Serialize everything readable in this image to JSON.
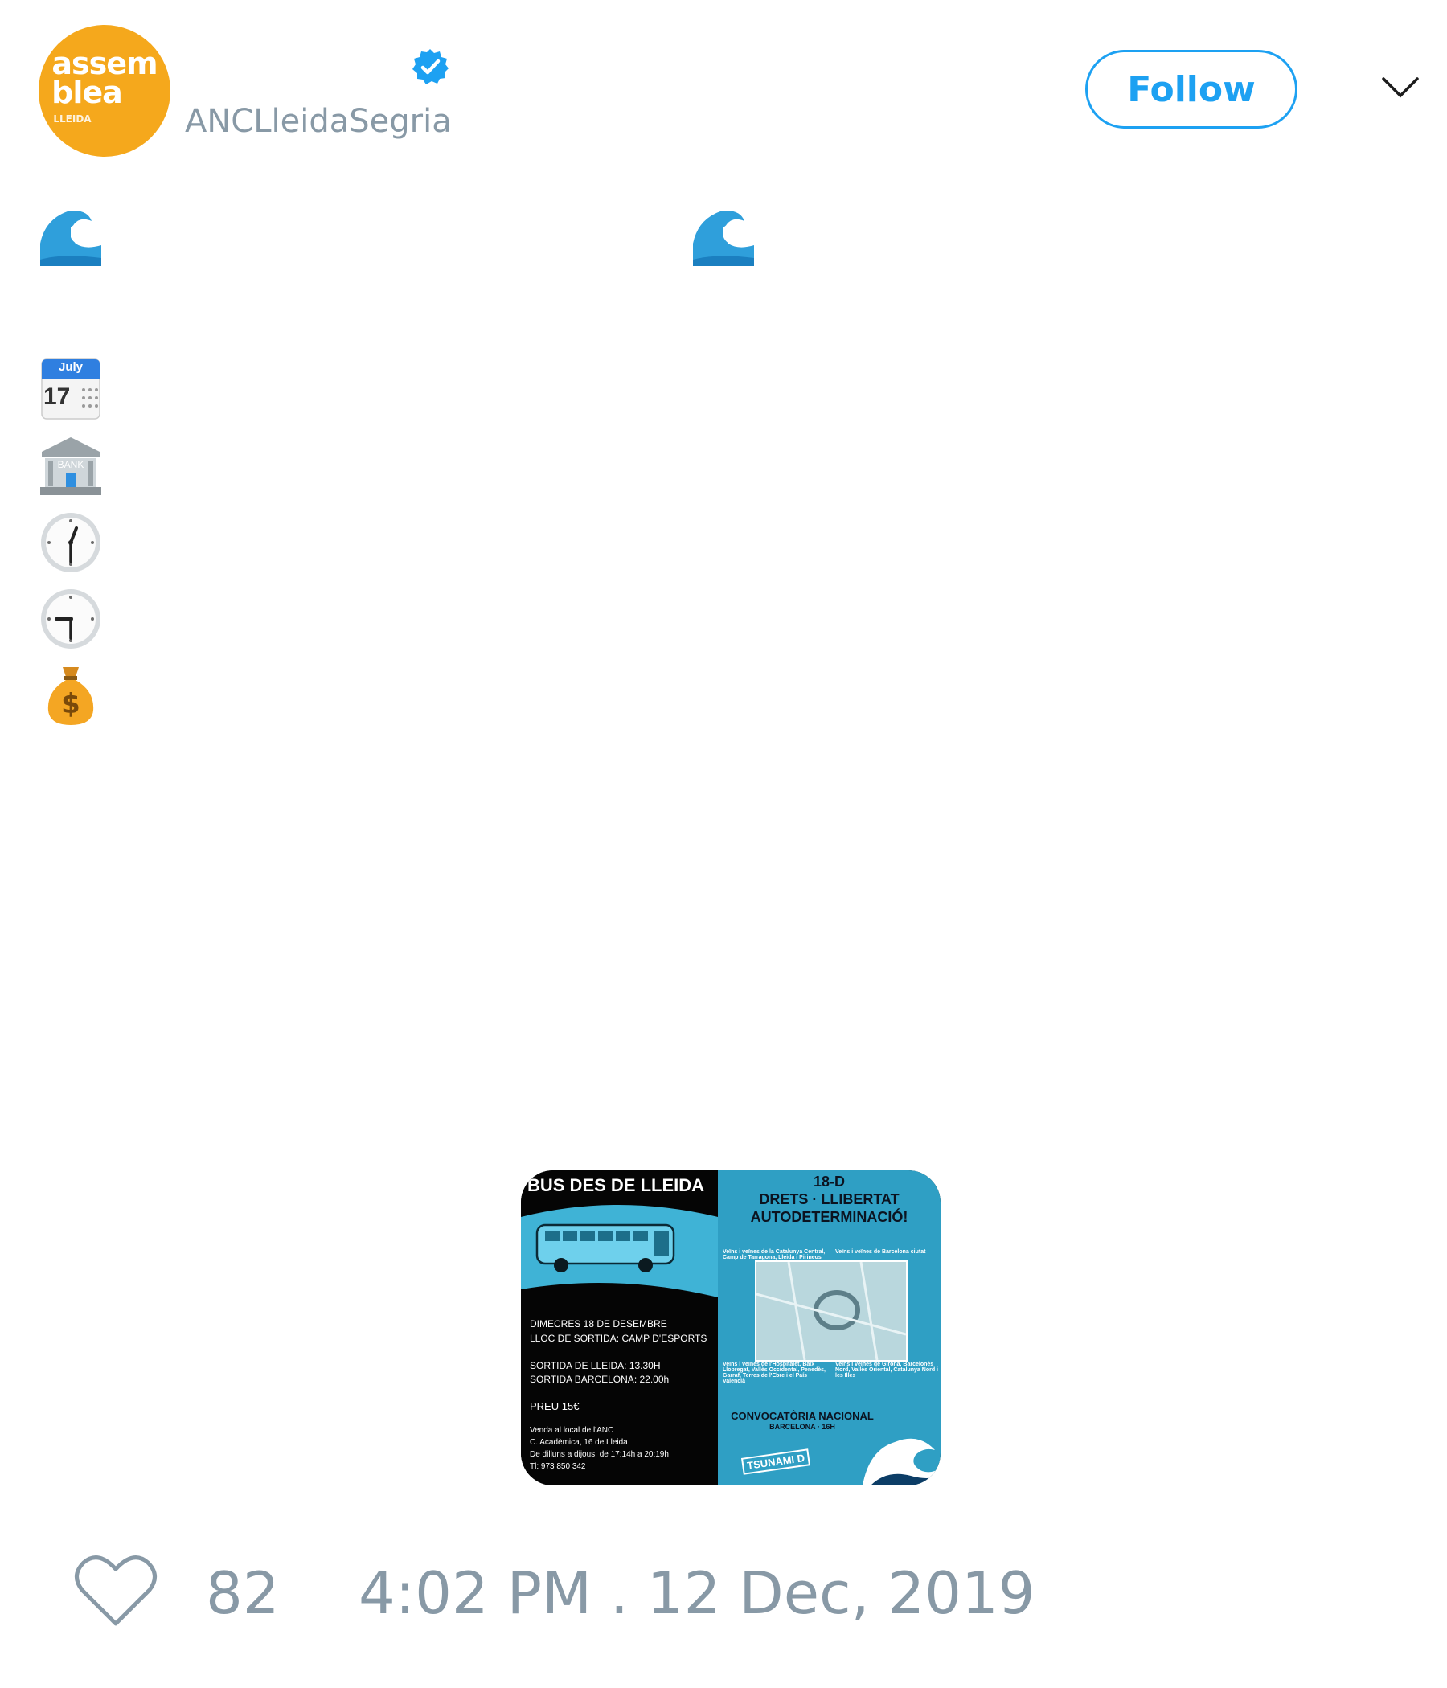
{
  "author": {
    "handle": "ANCLleidaSegria",
    "avatar_logo_lines": [
      "assem",
      "blea",
      "LLEIDA"
    ],
    "verified_icon": "verified-badge-icon"
  },
  "header": {
    "follow_label": "Follow",
    "menu_icon": "chevron-down-icon"
  },
  "tweet_body": {
    "emojis": [
      {
        "name": "water-wave-icon"
      },
      {
        "name": "water-wave-icon"
      },
      {
        "name": "calendar-icon",
        "text": "July",
        "day": "17"
      },
      {
        "name": "bank-icon",
        "text": "BANK"
      },
      {
        "name": "clock-one-thirty-icon"
      },
      {
        "name": "clock-nine-thirty-icon"
      },
      {
        "name": "money-bag-icon",
        "text": "$"
      }
    ]
  },
  "media": {
    "title": "BUS DES DE LLEIDA",
    "left_lines": [
      "DIMECRES 18 DE DESEMBRE",
      "LLOC DE SORTIDA: CAMP D'ESPORTS",
      "SORTIDA DE LLEIDA: 13.30H",
      "SORTIDA BARCELONA: 22.00h",
      "PREU 15€",
      "Venda al local de l'ANC",
      "C. Acadèmica, 16 de Lleida",
      "De dilluns a dijous, de 17:14h a 20:19h",
      "Tl: 973 850 342"
    ],
    "right_title_1": "18-D",
    "right_title_2": "DRETS · LLIBERTAT",
    "right_title_3": "AUTODETERMINACIÓ!",
    "route_notes": [
      "Veïns i veïnes de la Catalunya Central, Camp de Tarragona, Lleida i Pirineus",
      "Veïns i veïnes de Barcelona ciutat",
      "Veïns i veïnes de l'Hospitalet, Baix Llobregat, Vallès Occidental, Penedès, Garraf, Terres de l'Ebre i el País Valencià",
      "Veïns i veïnes de Girona, Barcelonès Nord, Vallès Oriental, Catalunya Nord i les Illes"
    ],
    "convocatoria": "CONVOCATÒRIA NACIONAL",
    "convocatoria_sub": "BARCELONA · 16H",
    "brand": "TSUNAMI D"
  },
  "footer": {
    "likes": "82",
    "timestamp": "4:02 PM . 12 Dec, 2019"
  },
  "colors": {
    "accent": "#1da1f2",
    "muted": "#8899a6",
    "avatar_bg": "#f5a81c",
    "poster_blue": "#2f9fc4"
  }
}
